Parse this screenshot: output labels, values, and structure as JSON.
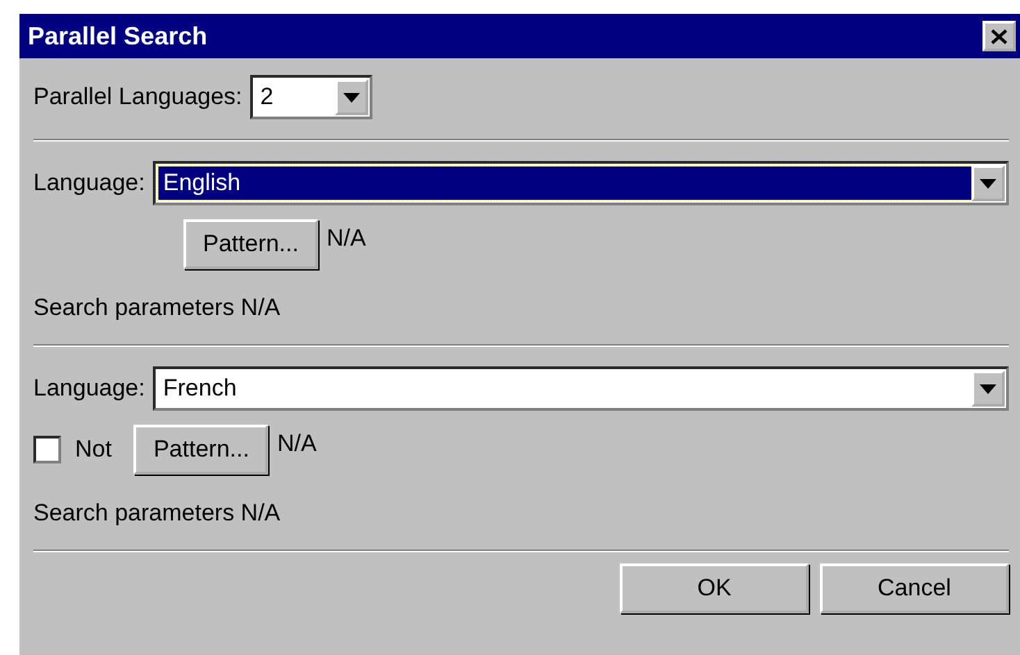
{
  "window": {
    "title": "Parallel Search"
  },
  "parallel_languages": {
    "label": "Parallel Languages:",
    "value": "2"
  },
  "sections": [
    {
      "language_label": "Language:",
      "language": "English",
      "focused": true,
      "pattern_button": "Pattern...",
      "pattern_value": "N/A",
      "parameters": "Search parameters N/A"
    },
    {
      "language_label": "Language:",
      "language": "French",
      "focused": false,
      "not_checkbox": {
        "label": "Not",
        "checked": false
      },
      "pattern_button": "Pattern...",
      "pattern_value": "N/A",
      "parameters": "Search parameters N/A"
    }
  ],
  "buttons": [
    "OK",
    "Cancel"
  ]
}
